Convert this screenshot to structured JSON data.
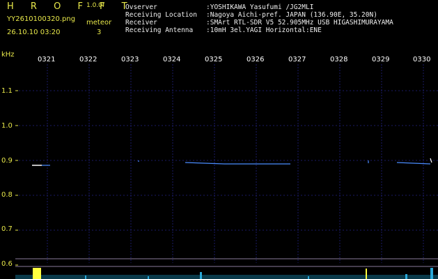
{
  "header": {
    "brand": "H R O F F T",
    "version": "1.0.0f",
    "filename": "YY2610100320.png",
    "timestamp": "26.10.10 03:20",
    "meteor_label": "meteor",
    "meteor_count": "3"
  },
  "info": [
    {
      "key": "Ovserver",
      "value": ":YOSHIKAWA Yasufumi /JG2MLI"
    },
    {
      "key": "Receiving Location",
      "value": ":Nagoya Aichi-pref. JAPAN (136.90E, 35.20N)"
    },
    {
      "key": "Receiver",
      "value": ":SMArt RTL-SDR V5 52.905MHz USB HIGASHIMURAYAMA"
    },
    {
      "key": "Receiving Antenna",
      "value": ":10mH 3el.YAGI Horizontal:ENE"
    }
  ],
  "y_unit": "kHz",
  "time_labels": [
    "0321",
    "0322",
    "0323",
    "0324",
    "0325",
    "0326",
    "0327",
    "0328",
    "0329",
    "0330"
  ],
  "freq_labels": [
    "1.1",
    "1.0",
    "0.9",
    "0.8",
    "0.7",
    "0.6"
  ],
  "colors": {
    "label_yellow": "#e8e84a",
    "grid": "#1a1a66",
    "signal": "#4a8cff",
    "noise": "#2aa8d8",
    "burst": "#ffff40"
  }
}
